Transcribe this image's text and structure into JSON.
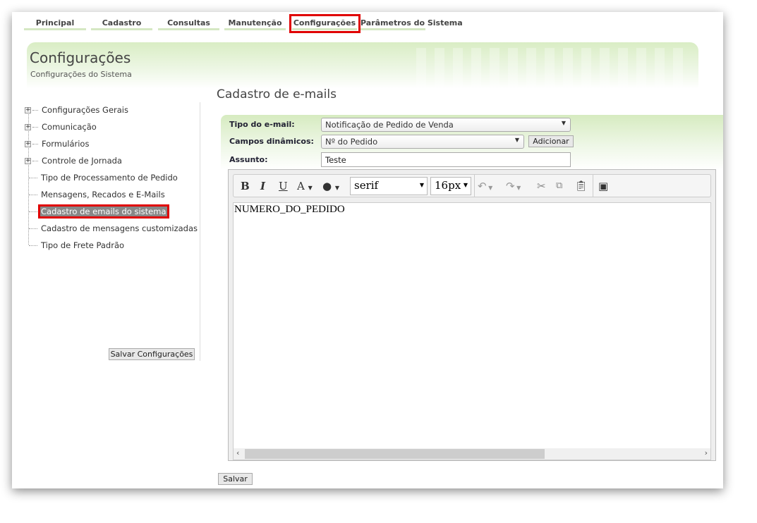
{
  "nav": {
    "tabs": [
      "Principal",
      "Cadastro",
      "Consultas",
      "Manutenção",
      "Configurações",
      "Parâmetros do Sistema"
    ],
    "active": "Configurações"
  },
  "header": {
    "title": "Configurações",
    "subtitle": "Configurações do Sistema"
  },
  "sidebar": {
    "items": [
      {
        "label": "Configurações Gerais",
        "expandable": true
      },
      {
        "label": "Comunicação",
        "expandable": true
      },
      {
        "label": "Formulários",
        "expandable": true
      },
      {
        "label": "Controle de Jornada",
        "expandable": true
      },
      {
        "label": "Tipo de Processamento de Pedido",
        "expandable": false
      },
      {
        "label": "Mensagens, Recados e E-Mails",
        "expandable": false
      },
      {
        "label": "Cadastro de emails do sistema",
        "expandable": false,
        "selected": true
      },
      {
        "label": "Cadastro de mensagens customizadas",
        "expandable": false
      },
      {
        "label": "Tipo de Frete Padrão",
        "expandable": false
      }
    ],
    "save_label": "Salvar Configurações"
  },
  "main": {
    "title": "Cadastro de e-mails",
    "form": {
      "tipo_label": "Tipo do e-mail:",
      "tipo_value": "Notificação de Pedido de Venda",
      "campos_label": "Campos dinâmicos:",
      "campos_value": "Nº do Pedido",
      "add_label": "Adicionar",
      "assunto_label": "Assunto:",
      "assunto_value": "Teste"
    },
    "editor": {
      "bold": "B",
      "italic": "I",
      "underline": "U",
      "font_color": "A",
      "font": "serif",
      "size": "16px",
      "content": "NUMERO_DO_PEDIDO"
    },
    "save_label": "Salvar"
  },
  "colors": {
    "highlight": "#e00000",
    "accent": "#d5e8c3"
  }
}
